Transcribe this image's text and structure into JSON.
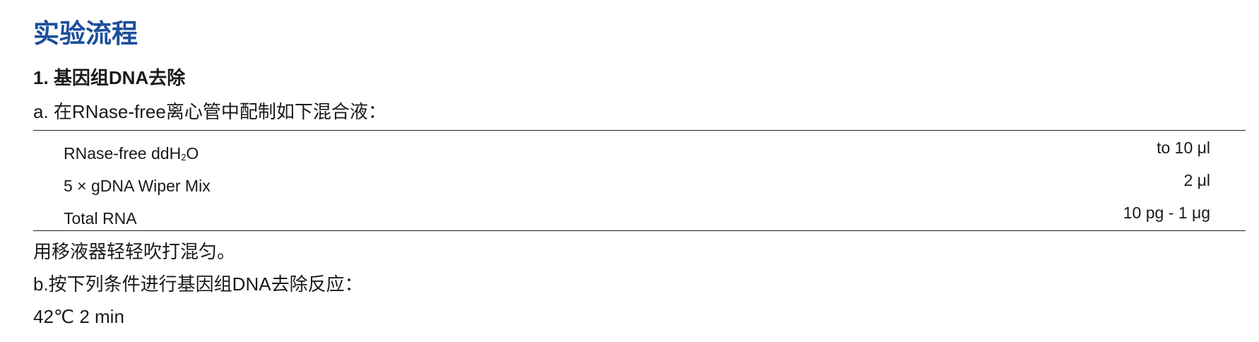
{
  "title": "实验流程",
  "section": {
    "heading": "1. 基因组DNA去除"
  },
  "step_a": "a. 在RNase-free离心管中配制如下混合液：",
  "mix_table": {
    "rows": [
      {
        "name_prefix": "RNase-free ddH",
        "name_sub": "2",
        "name_suffix": "O",
        "amount": "to 10 μl"
      },
      {
        "name": "5 × gDNA Wiper Mix",
        "amount": "2 μl"
      },
      {
        "name": "Total RNA",
        "amount": "10 pg - 1 μg"
      }
    ]
  },
  "note": "用移液器轻轻吹打混匀。",
  "step_b": "b.按下列条件进行基因组DNA去除反应：",
  "condition": "42℃ 2 min",
  "colors": {
    "title": "#1d4f9c",
    "text": "#1a1a1a",
    "rule": "#222222"
  }
}
